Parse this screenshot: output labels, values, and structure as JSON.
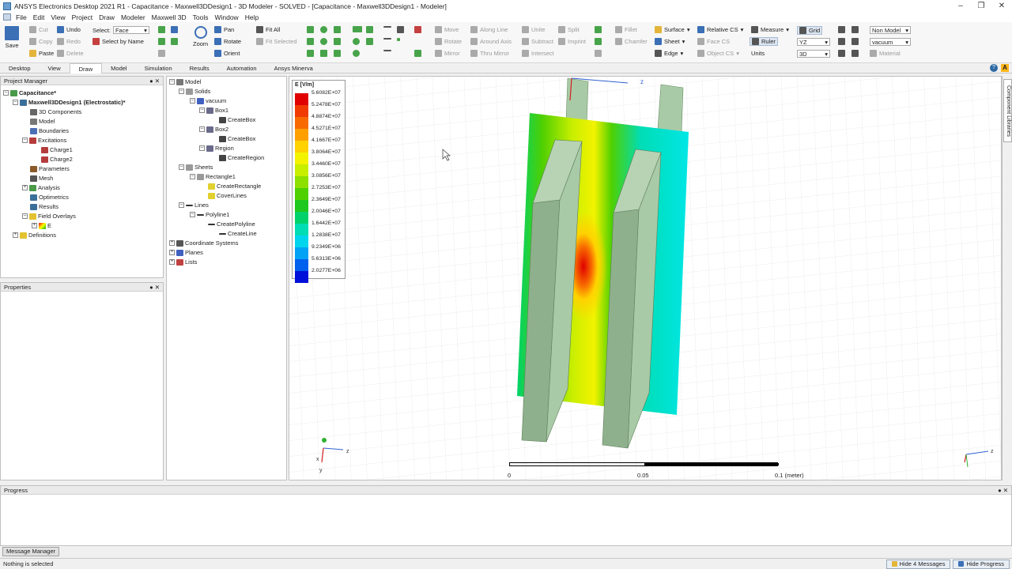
{
  "window": {
    "title": "ANSYS Electronics Desktop 2021 R1 - Capacitance - Maxwell3DDesign1 - 3D Modeler - SOLVED - [Capacitance - Maxwell3DDesign1 - Modeler]"
  },
  "menu": [
    "File",
    "Edit",
    "View",
    "Project",
    "Draw",
    "Modeler",
    "Maxwell 3D",
    "Tools",
    "Window",
    "Help"
  ],
  "ribbon": {
    "save": "Save",
    "cut": "Cut",
    "copy": "Copy",
    "paste": "Paste",
    "undo": "Undo",
    "redo": "Redo",
    "delete": "Delete",
    "select_label": "Select:",
    "select_value": "Face",
    "select_by_name": "Select by Name",
    "zoom": "Zoom",
    "pan": "Pan",
    "rotate": "Rotate",
    "orient": "Orient",
    "fit_all": "Fit All",
    "fit_selected": "Fit Selected",
    "move": "Move",
    "rotate2": "Rotate",
    "mirror": "Mirror",
    "along_line": "Along Line",
    "around_axis": "Around Axis",
    "thru_mirror": "Thru Mirror",
    "unite": "Unite",
    "subtract": "Subtract",
    "intersect": "Intersect",
    "split": "Split",
    "imprint": "Imprint",
    "fillet": "Fillet",
    "chamfer": "Chamfer",
    "surface": "Surface",
    "sheet": "Sheet",
    "edge": "Edge",
    "relative_cs": "Relative CS",
    "face_cs": "Face CS",
    "object_cs": "Object CS",
    "measure": "Measure",
    "ruler": "Ruler",
    "units": "Units",
    "grid": "Grid",
    "plane": "YZ",
    "dim": "3D",
    "model_type": "Non Model",
    "material_sel": "vacuum",
    "material": "Material"
  },
  "tabs": [
    "Desktop",
    "View",
    "Draw",
    "Model",
    "Simulation",
    "Results",
    "Automation",
    "Ansys Minerva"
  ],
  "project_manager": {
    "title": "Project Manager",
    "nodes": [
      "Capacitance*",
      "Maxwell3DDesign1 (Electrostatic)*",
      "3D Components",
      "Model",
      "Boundaries",
      "Excitations",
      "Charge1",
      "Charge2",
      "Parameters",
      "Mesh",
      "Analysis",
      "Optimetrics",
      "Results",
      "Field Overlays",
      "E",
      "Definitions"
    ]
  },
  "properties": {
    "title": "Properties"
  },
  "model_tree": {
    "nodes": [
      "Model",
      "Solids",
      "vacuum",
      "Box1",
      "CreateBox",
      "Box2",
      "CreateBox",
      "Region",
      "CreateRegion",
      "Sheets",
      "Rectangle1",
      "CreateRectangle",
      "CoverLines",
      "Lines",
      "Polyline1",
      "CreatePolyline",
      "CreateLine",
      "Coordinate Systems",
      "Planes",
      "Lists"
    ]
  },
  "legend": {
    "title": "E [V/m]",
    "values": [
      "5.6082E+07",
      "5.2478E+07",
      "4.8874E+07",
      "4.5271E+07",
      "4.1667E+07",
      "3.8064E+07",
      "3.4460E+07",
      "3.0856E+07",
      "2.7253E+07",
      "2.3649E+07",
      "2.0046E+07",
      "1.6442E+07",
      "1.2838E+07",
      "9.2349E+06",
      "5.6313E+06",
      "2.0277E+06"
    ],
    "colors": [
      "#e00000",
      "#f03a00",
      "#f86a00",
      "#ffa000",
      "#ffd200",
      "#f3f300",
      "#c8ee00",
      "#8ee000",
      "#50d000",
      "#1fc81f",
      "#00d26b",
      "#00ddb5",
      "#00d5ee",
      "#00a2f6",
      "#0060ee",
      "#0010d8"
    ]
  },
  "scale": {
    "labels": [
      "0",
      "0.05",
      "0.1 (meter)"
    ]
  },
  "axes": {
    "y": "y",
    "z": "z",
    "x": "x"
  },
  "progress": {
    "title": "Progress"
  },
  "message_manager": "Message Manager",
  "status": {
    "text": "Nothing is selected",
    "hide_messages": "Hide 4 Messages",
    "hide_progress": "Hide Progress"
  }
}
